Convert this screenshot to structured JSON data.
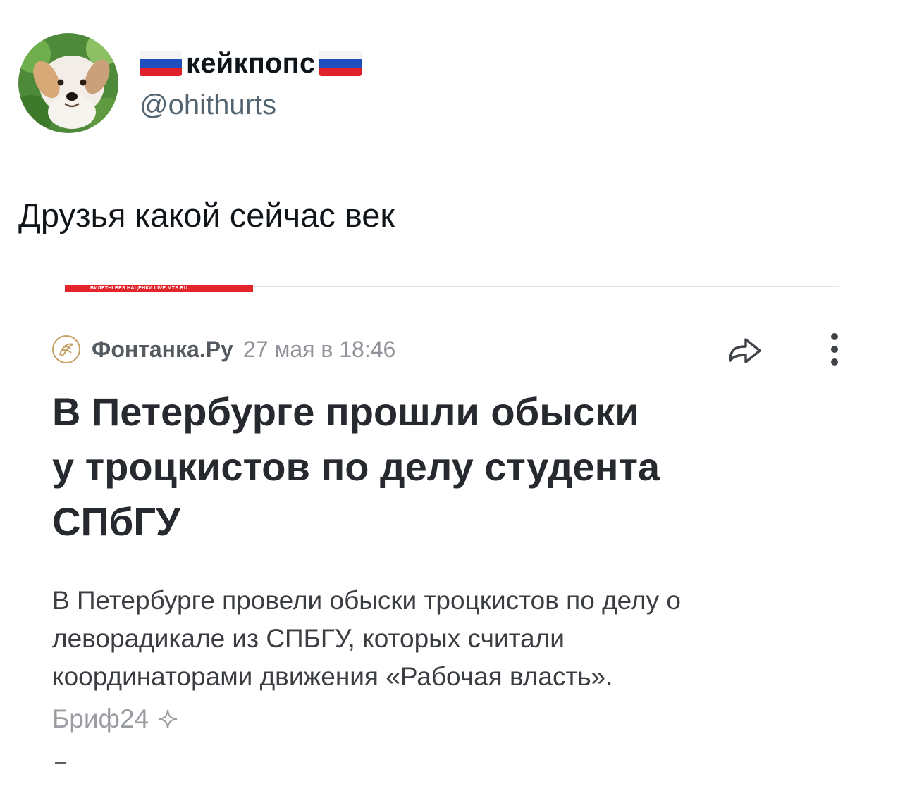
{
  "tweet": {
    "author": {
      "display_name": "кейкпопс",
      "handle": "@ohithurts",
      "avatar_icon": "dog-avatar",
      "name_decoration_icon": "russian-flag-icon"
    },
    "text": "Друзья какой сейчас век"
  },
  "attached_screenshot": {
    "banner_text": "БИЛЕТЫ БЕЗ НАЦЕНКИ LIVE.MTS.RU",
    "source": {
      "name": "Фонтанка.Ру",
      "date": "27 мая в 18:46",
      "logo_icon": "fontanka-logo-icon"
    },
    "headline_lines": [
      "В Петербурге прошли обыски",
      "у троцкистов по делу студента",
      "СПбГУ"
    ],
    "summary_lines": [
      "В Петербурге провели обыски троцкистов по делу о",
      "леворадикале из СПБГУ, которых считали",
      "координаторами движения «Рабочая власть»."
    ],
    "summary_source": "Бриф24",
    "colors": {
      "banner": "#e3242b",
      "headline": "#26292e",
      "muted": "#8f9399"
    }
  }
}
